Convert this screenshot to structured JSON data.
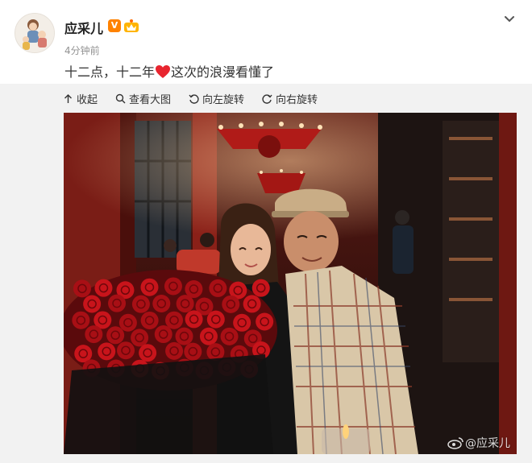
{
  "author": {
    "name": "应采儿",
    "verified_badge": "V",
    "avatar_icon": "cartoon-family-avatar"
  },
  "post": {
    "time": "4分钟前",
    "text_before": "十二点，十二年",
    "text_after": "这次的浪漫看懂了",
    "emoji": "red-heart-icon"
  },
  "toolbar": {
    "collapse": "收起",
    "view_large": "查看大图",
    "rotate_left": "向左旋转",
    "rotate_right": "向右旋转"
  },
  "photo": {
    "watermark": "@应采儿"
  },
  "colors": {
    "accent": "#ff8200",
    "heart": "#e8252f",
    "panel_bg": "#f2f2f2",
    "muted_text": "#939393"
  }
}
